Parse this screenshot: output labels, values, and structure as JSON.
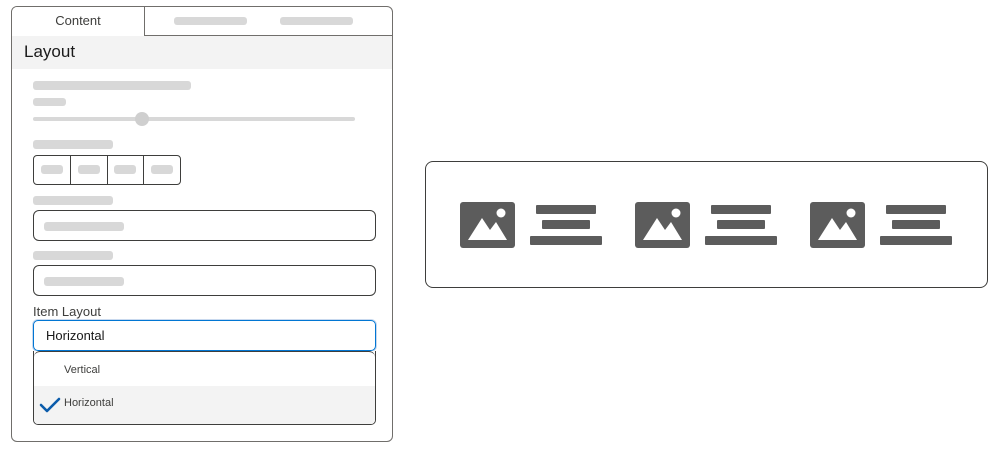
{
  "panel": {
    "tabs": [
      {
        "label": "Content",
        "active": true
      },
      {
        "label": "",
        "active": false
      },
      {
        "label": "",
        "active": false
      }
    ],
    "section_title": "Layout",
    "item_layout": {
      "label": "Item Layout",
      "value": "Horizontal",
      "options": [
        {
          "label": "Vertical",
          "selected": false
        },
        {
          "label": "Horizontal",
          "selected": true
        }
      ]
    }
  },
  "preview": {
    "layout": "horizontal",
    "cards": [
      {
        "icon": "image-icon"
      },
      {
        "icon": "image-icon"
      },
      {
        "icon": "image-icon"
      }
    ]
  },
  "colors": {
    "accent": "#0176d3",
    "check": "#0b5cab",
    "border": "#3e3e3c",
    "placeholder": "#d8d8d8",
    "preview_fill": "#5c5c5c"
  }
}
